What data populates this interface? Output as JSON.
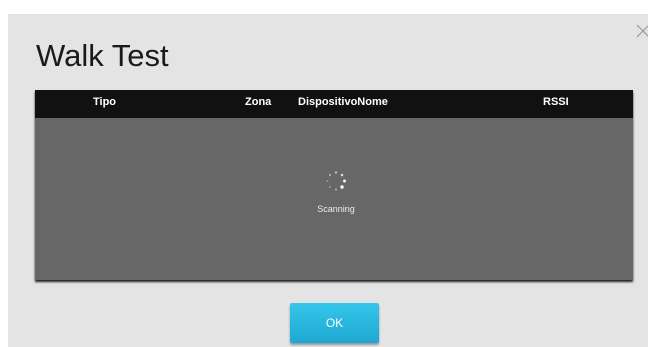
{
  "dialog": {
    "title": "Walk Test",
    "close_icon": "close-icon"
  },
  "table": {
    "columns": [
      "Tipo",
      "Zona",
      "DispositivoNome",
      "RSSI"
    ],
    "status_text": "Scanning",
    "spinner_icon": "loading-spinner-icon"
  },
  "actions": {
    "ok_label": "OK"
  },
  "colors": {
    "dialog_background": "#e4e4e4",
    "table_header": "#111111",
    "table_body": "#676767",
    "ok_button": "#29b8e0"
  }
}
